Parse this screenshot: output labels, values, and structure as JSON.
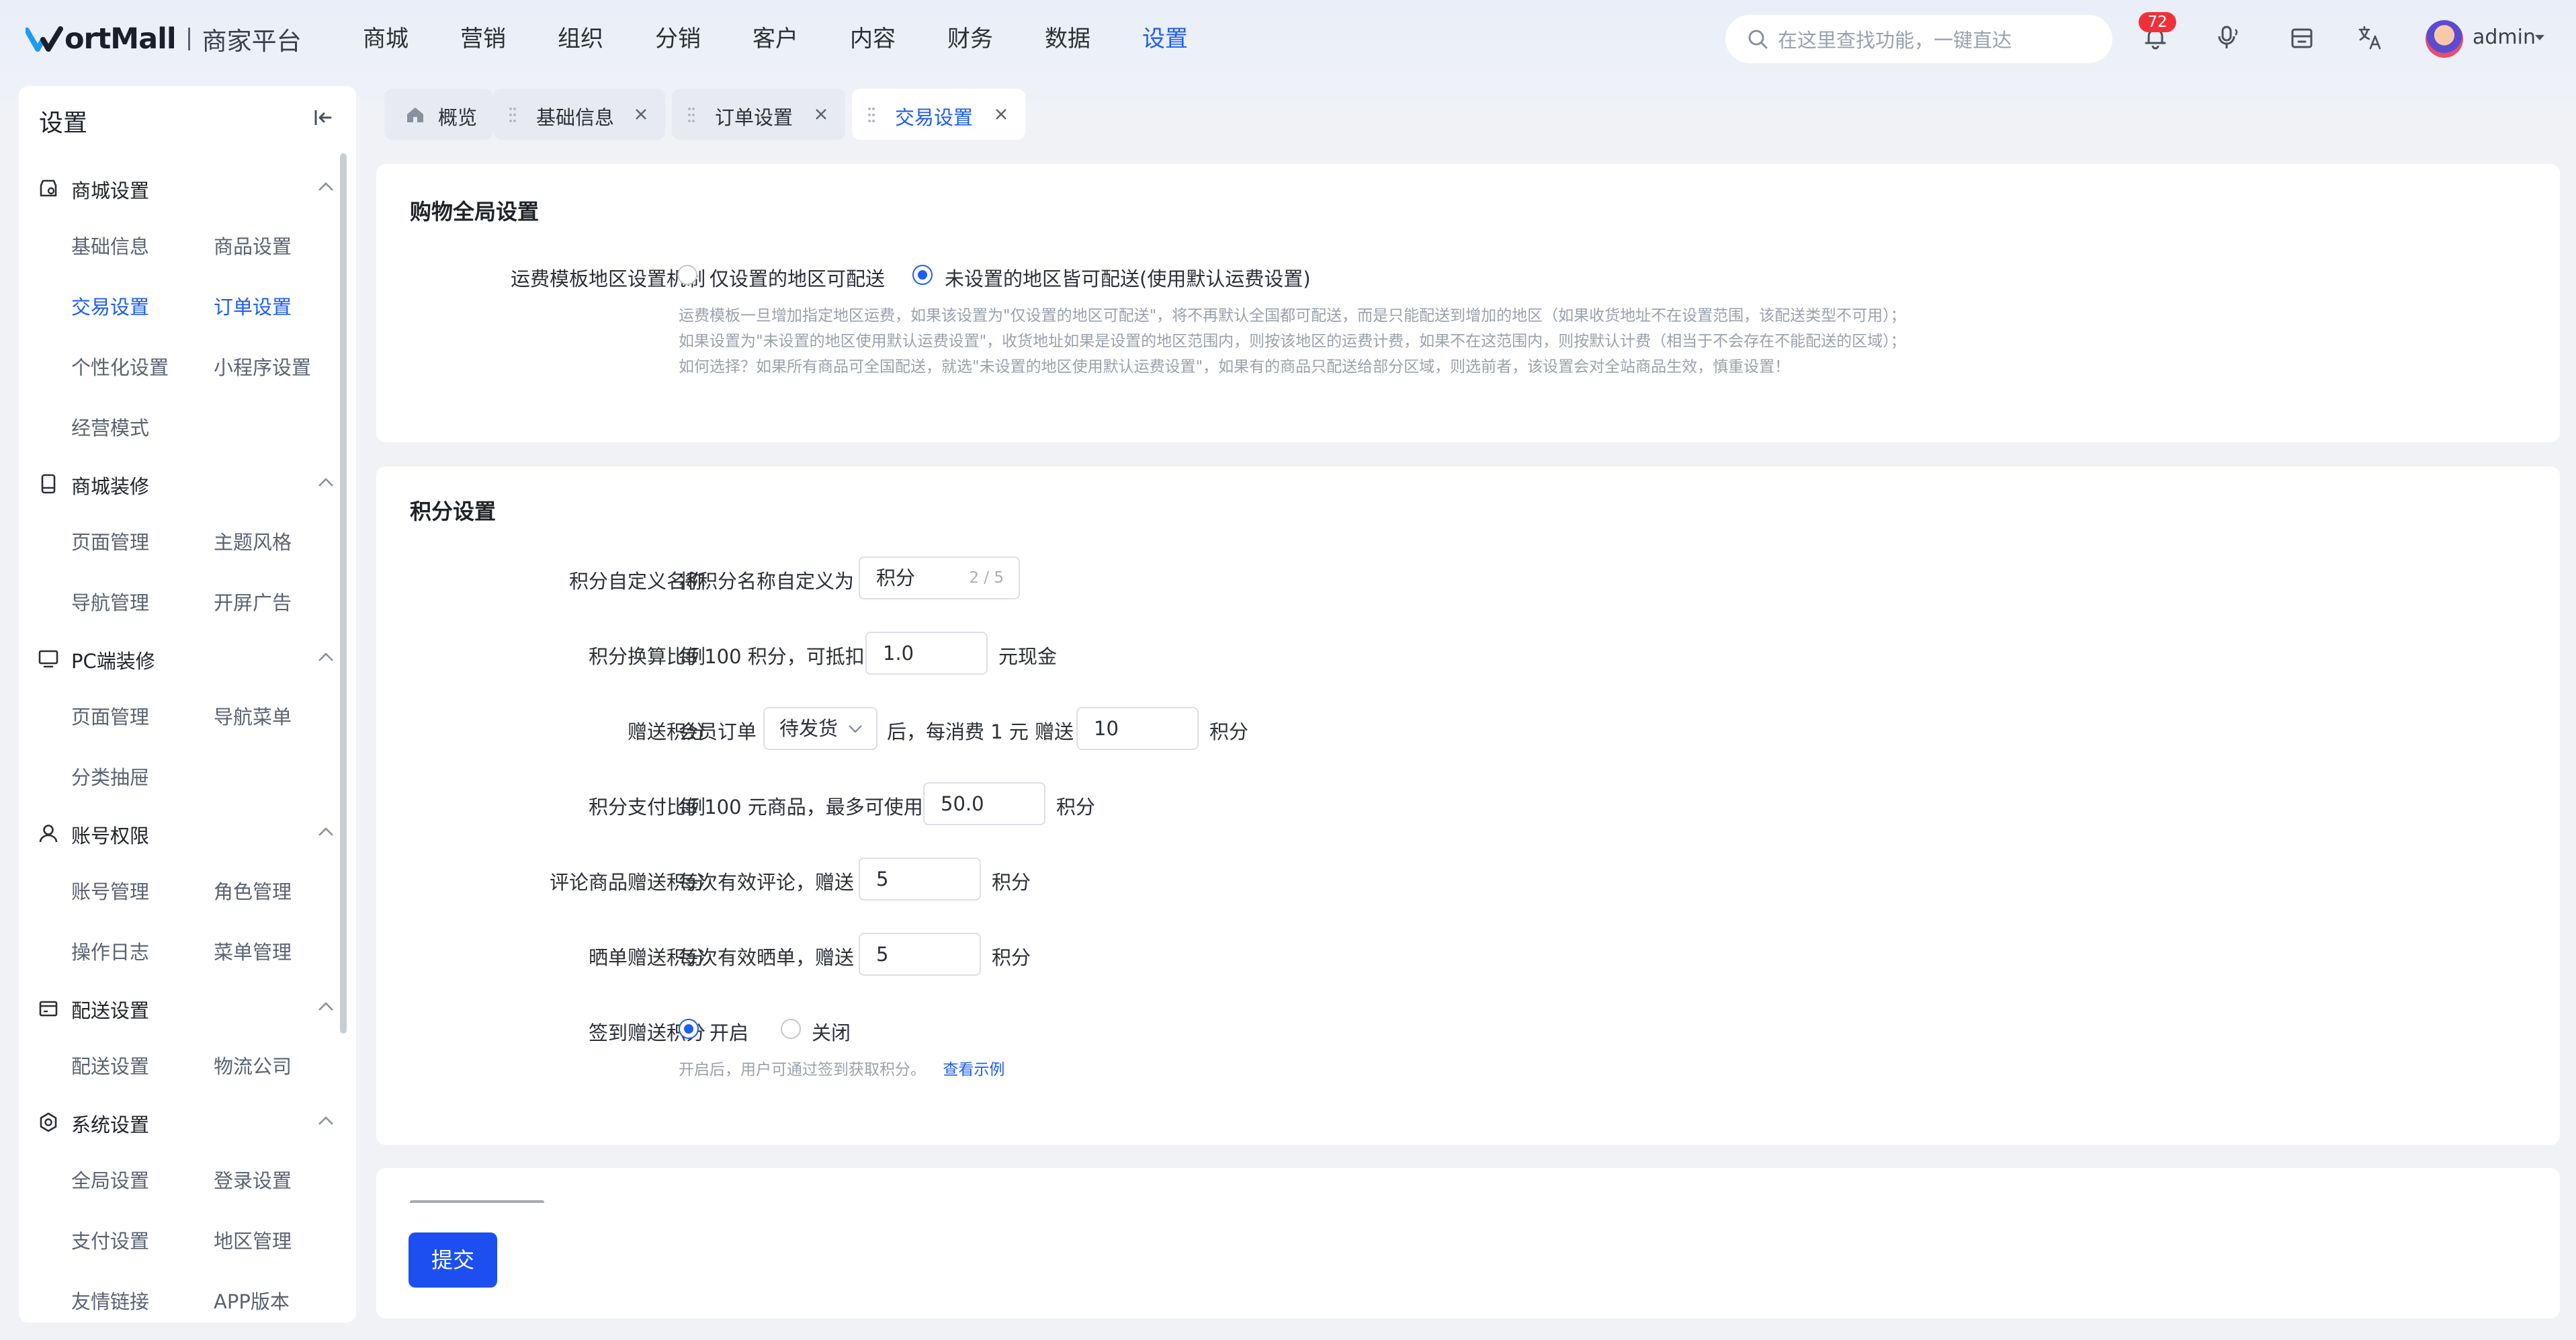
{
  "app": {
    "logo_text": "ortMall",
    "platform": "商家平台"
  },
  "topnav": [
    "商城",
    "营销",
    "组织",
    "分销",
    "客户",
    "内容",
    "财务",
    "数据",
    "设置"
  ],
  "topnav_active": "设置",
  "search": {
    "placeholder": "在这里查找功能，一键直达"
  },
  "notifications": {
    "count": "72"
  },
  "user": {
    "name": "admin"
  },
  "sidebar": {
    "title": "设置",
    "groups": [
      {
        "label": "商城设置",
        "icon": "store-settings-icon",
        "items": [
          "基础信息",
          "商品设置",
          "交易设置",
          "订单设置",
          "个性化设置",
          "小程序设置",
          "经营模式"
        ]
      },
      {
        "label": "商城装修",
        "icon": "tablet-icon",
        "items": [
          "页面管理",
          "主题风格",
          "导航管理",
          "开屏广告"
        ]
      },
      {
        "label": "PC端装修",
        "icon": "monitor-icon",
        "items": [
          "页面管理",
          "导航菜单",
          "分类抽屉"
        ]
      },
      {
        "label": "账号权限",
        "icon": "user-icon",
        "items": [
          "账号管理",
          "角色管理",
          "操作日志",
          "菜单管理"
        ]
      },
      {
        "label": "配送设置",
        "icon": "delivery-icon",
        "items": [
          "配送设置",
          "物流公司"
        ]
      },
      {
        "label": "系统设置",
        "icon": "system-icon",
        "items": [
          "全局设置",
          "登录设置",
          "支付设置",
          "地区管理",
          "友情链接",
          "APP版本"
        ]
      }
    ],
    "active_items": [
      "交易设置",
      "订单设置"
    ]
  },
  "tabs": [
    {
      "label": "概览",
      "icon": "home-icon"
    },
    {
      "label": "基础信息"
    },
    {
      "label": "订单设置"
    },
    {
      "label": "交易设置"
    }
  ],
  "shopping": {
    "title": "购物全局设置",
    "label": "运费模板地区设置机制",
    "option1": "仅设置的地区可配送",
    "option2": "未设置的地区皆可配送(使用默认运费设置)",
    "selected": 2,
    "help1": "运费模板一旦增加指定地区运费，如果该设置为\"仅设置的地区可配送\"，将不再默认全国都可配送，而是只能配送到增加的地区（如果收货地址不在设置范围，该配送类型不可用）；",
    "help2": "如果设置为\"未设置的地区使用默认运费设置\"，收货地址如果是设置的地区范围内，则按该地区的运费计费，如果不在这范围内，则按默认计费（相当于不会存在不能配送的区域）；",
    "help3": "如何选择？如果所有商品可全国配送，就选\"未设置的地区使用默认运费设置\"，如果有的商品只配送给部分区域，则选前者，该设置会对全站商品生效，慎重设置！"
  },
  "points": {
    "title": "积分设置",
    "name": {
      "label": "积分自定义名称",
      "prefix": "将积分名称自定义为",
      "value": "积分",
      "count": "2 / 5"
    },
    "rate": {
      "label": "积分换算比例",
      "prefix": "每 100 积分，可抵扣",
      "value": "1.0",
      "suffix": "元现金"
    },
    "gift": {
      "label": "赠送积分",
      "prefix": "会员订单",
      "select": "待发货",
      "mid": "后，每消费 1 元 赠送",
      "value": "10",
      "suffix": "积分"
    },
    "pay": {
      "label": "积分支付比例",
      "prefix": "每 100 元商品，最多可使用",
      "value": "50.0",
      "suffix": "积分"
    },
    "review": {
      "label": "评论商品赠送积分",
      "prefix": "每次有效评论，赠送",
      "value": "5",
      "suffix": "积分"
    },
    "share": {
      "label": "晒单赠送积分",
      "prefix": "每次有效晒单，赠送",
      "value": "5",
      "suffix": "积分"
    },
    "signin": {
      "label": "签到赠送积分",
      "on": "开启",
      "off": "关闭",
      "selected": "开启",
      "help": "开启后，用户可通过签到获取积分。",
      "help_link": "查看示例"
    }
  },
  "footer": {
    "submit": "提交"
  },
  "colors": {
    "primary": "#1d5cf5",
    "badge": "#f0313a",
    "submit": "#1d4ff0"
  }
}
